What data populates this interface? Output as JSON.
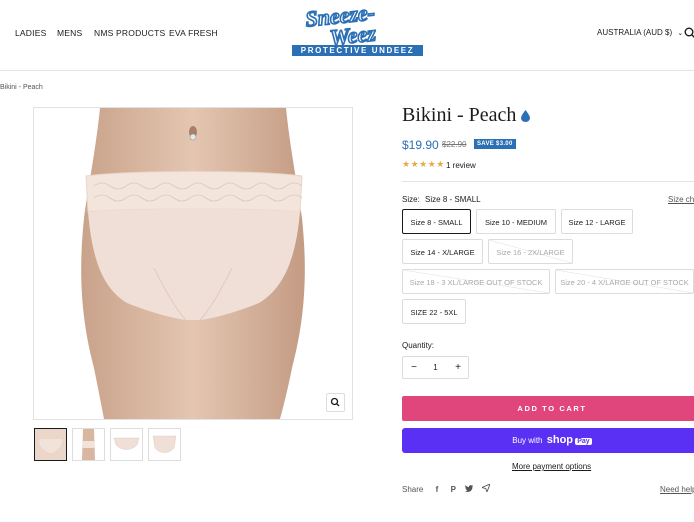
{
  "nav": {
    "items": [
      "LADIES",
      "MENS",
      "NMS PRODUCTS",
      "EVA FRESH"
    ],
    "currency": "AUSTRALIA (AUD $)"
  },
  "logo": {
    "line1": "Sneeze-",
    "line2": "Weez",
    "band": "PROTECTIVE UNDEEZ"
  },
  "breadcrumb": "Bikini - Peach",
  "product": {
    "title": "Bikini - Peach",
    "price": "$19.90",
    "compare_price": "$22.90",
    "save_badge": "SAVE $3.00",
    "stars": "★★★★★",
    "rating": 5,
    "reviews": "1 review",
    "size_label": "Size:",
    "size_value": "Size 8 - SMALL",
    "size_chart": "Size cha",
    "sizes": [
      "Size 8 - SMALL",
      "Size 10 - MEDIUM",
      "Size 12 - LARGE",
      "Size 14 - X/LARGE",
      "Size 16 - 2X/LARGE",
      "Size 18 - 3 XL/LARGE OUT OF STOCK",
      "Size 20 - 4 X/LARGE OUT OF STOCK",
      "SIZE 22 - 5XL"
    ],
    "quantity_label": "Quantity:",
    "quantity": "1",
    "add_to_cart": "ADD TO CART",
    "buy_with": "Buy with",
    "shop": "shop",
    "pay": "Pay",
    "more_payment": "More payment options",
    "share": "Share",
    "need_help": "Need help"
  },
  "colors": {
    "accent_blue": "#2b6fb4",
    "cart_pink": "#e0457b",
    "shoppay_purple": "#5a31f4",
    "star": "#e8a94a"
  },
  "icons": [
    "search-icon",
    "chevron-down-icon",
    "water-drop-icon",
    "zoom-icon",
    "minus-icon",
    "plus-icon",
    "facebook-icon",
    "pinterest-icon",
    "twitter-icon",
    "email-icon"
  ]
}
